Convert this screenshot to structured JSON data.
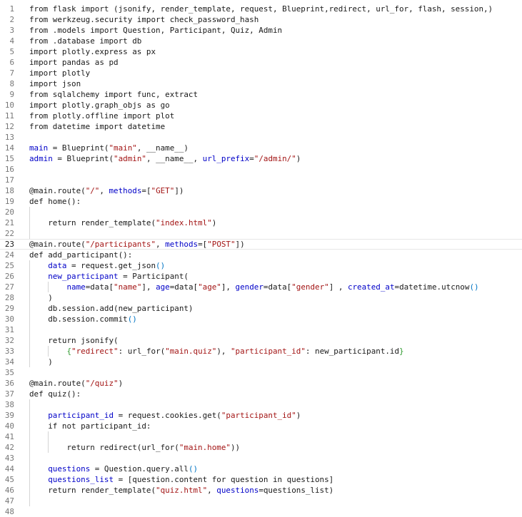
{
  "editor": {
    "current_line": 23,
    "lines": [
      {
        "n": "1",
        "indent": 0,
        "parts": [
          {
            "t": "from flask import (jsonify, render_template, request, Blueprint,redirect, url_for, flash, session,)",
            "c": "plain"
          }
        ]
      },
      {
        "n": "2",
        "indent": 0,
        "parts": [
          {
            "t": "from werkzeug.security import check_password_hash",
            "c": "plain"
          }
        ]
      },
      {
        "n": "3",
        "indent": 0,
        "parts": [
          {
            "t": "from .models import Question, Participant, Quiz, Admin",
            "c": "plain"
          }
        ]
      },
      {
        "n": "4",
        "indent": 0,
        "parts": [
          {
            "t": "from .database import db",
            "c": "plain"
          }
        ]
      },
      {
        "n": "5",
        "indent": 0,
        "parts": [
          {
            "t": "import plotly.express as px",
            "c": "plain"
          }
        ]
      },
      {
        "n": "6",
        "indent": 0,
        "parts": [
          {
            "t": "import pandas as pd",
            "c": "plain"
          }
        ]
      },
      {
        "n": "7",
        "indent": 0,
        "parts": [
          {
            "t": "import plotly",
            "c": "plain"
          }
        ]
      },
      {
        "n": "8",
        "indent": 0,
        "parts": [
          {
            "t": "import json",
            "c": "plain"
          }
        ]
      },
      {
        "n": "9",
        "indent": 0,
        "parts": [
          {
            "t": "from sqlalchemy import func, extract",
            "c": "plain"
          }
        ]
      },
      {
        "n": "10",
        "indent": 0,
        "parts": [
          {
            "t": "import plotly.graph_objs as go",
            "c": "plain"
          }
        ]
      },
      {
        "n": "11",
        "indent": 0,
        "parts": [
          {
            "t": "from plotly.offline import plot",
            "c": "plain"
          }
        ]
      },
      {
        "n": "12",
        "indent": 0,
        "parts": [
          {
            "t": "from datetime import datetime",
            "c": "plain"
          }
        ]
      },
      {
        "n": "13",
        "indent": 0,
        "parts": []
      },
      {
        "n": "14",
        "indent": 0,
        "parts": [
          {
            "t": "main",
            "c": "var"
          },
          {
            "t": " = Blueprint(",
            "c": "plain"
          },
          {
            "t": "\"main\"",
            "c": "str"
          },
          {
            "t": ", __name__)",
            "c": "plain"
          }
        ]
      },
      {
        "n": "15",
        "indent": 0,
        "parts": [
          {
            "t": "admin",
            "c": "var"
          },
          {
            "t": " = Blueprint(",
            "c": "plain"
          },
          {
            "t": "\"admin\"",
            "c": "str"
          },
          {
            "t": ", __name__, ",
            "c": "plain"
          },
          {
            "t": "url_prefix",
            "c": "var"
          },
          {
            "t": "=",
            "c": "plain"
          },
          {
            "t": "\"/admin/\"",
            "c": "str"
          },
          {
            "t": ")",
            "c": "plain"
          }
        ]
      },
      {
        "n": "16",
        "indent": 0,
        "parts": []
      },
      {
        "n": "17",
        "indent": 0,
        "parts": []
      },
      {
        "n": "18",
        "indent": 0,
        "parts": [
          {
            "t": "@main.route(",
            "c": "plain"
          },
          {
            "t": "\"/\"",
            "c": "str"
          },
          {
            "t": ", ",
            "c": "plain"
          },
          {
            "t": "methods",
            "c": "var"
          },
          {
            "t": "=[",
            "c": "plain"
          },
          {
            "t": "\"GET\"",
            "c": "str"
          },
          {
            "t": "])",
            "c": "plain"
          }
        ]
      },
      {
        "n": "19",
        "indent": 0,
        "parts": [
          {
            "t": "def home():",
            "c": "plain"
          }
        ]
      },
      {
        "n": "20",
        "indent": 1,
        "parts": []
      },
      {
        "n": "21",
        "indent": 1,
        "parts": [
          {
            "t": "    return render_template(",
            "c": "plain"
          },
          {
            "t": "\"index.html\"",
            "c": "str"
          },
          {
            "t": ")",
            "c": "plain"
          }
        ]
      },
      {
        "n": "22",
        "indent": 1,
        "parts": []
      },
      {
        "n": "23",
        "indent": 0,
        "parts": [
          {
            "t": "@main.route(",
            "c": "plain"
          },
          {
            "t": "\"/participants\"",
            "c": "str"
          },
          {
            "t": ", ",
            "c": "plain"
          },
          {
            "t": "methods",
            "c": "var"
          },
          {
            "t": "=[",
            "c": "plain"
          },
          {
            "t": "\"POST\"",
            "c": "str"
          },
          {
            "t": "])",
            "c": "plain"
          }
        ]
      },
      {
        "n": "24",
        "indent": 0,
        "parts": [
          {
            "t": "def add_participant():",
            "c": "plain"
          }
        ]
      },
      {
        "n": "25",
        "indent": 1,
        "parts": [
          {
            "t": "    ",
            "c": "plain"
          },
          {
            "t": "data",
            "c": "var"
          },
          {
            "t": " = request.get_json",
            "c": "plain"
          },
          {
            "t": "()",
            "c": "lpar"
          }
        ]
      },
      {
        "n": "26",
        "indent": 1,
        "parts": [
          {
            "t": "    ",
            "c": "plain"
          },
          {
            "t": "new_participant",
            "c": "var"
          },
          {
            "t": " = Participant(",
            "c": "plain"
          }
        ]
      },
      {
        "n": "27",
        "indent": 2,
        "parts": [
          {
            "t": "        ",
            "c": "plain"
          },
          {
            "t": "name",
            "c": "var"
          },
          {
            "t": "=data[",
            "c": "plain"
          },
          {
            "t": "\"name\"",
            "c": "str"
          },
          {
            "t": "], ",
            "c": "plain"
          },
          {
            "t": "age",
            "c": "var"
          },
          {
            "t": "=data[",
            "c": "plain"
          },
          {
            "t": "\"age\"",
            "c": "str"
          },
          {
            "t": "], ",
            "c": "plain"
          },
          {
            "t": "gender",
            "c": "var"
          },
          {
            "t": "=data[",
            "c": "plain"
          },
          {
            "t": "\"gender\"",
            "c": "str"
          },
          {
            "t": "] , ",
            "c": "plain"
          },
          {
            "t": "created_at",
            "c": "var"
          },
          {
            "t": "=datetime.utcnow",
            "c": "plain"
          },
          {
            "t": "()",
            "c": "lpar"
          }
        ]
      },
      {
        "n": "28",
        "indent": 1,
        "parts": [
          {
            "t": "    )",
            "c": "plain"
          }
        ]
      },
      {
        "n": "29",
        "indent": 1,
        "parts": [
          {
            "t": "    db.session.add(new_participant)",
            "c": "plain"
          }
        ]
      },
      {
        "n": "30",
        "indent": 1,
        "parts": [
          {
            "t": "    db.session.commit",
            "c": "plain"
          },
          {
            "t": "()",
            "c": "lpar"
          }
        ]
      },
      {
        "n": "31",
        "indent": 1,
        "parts": []
      },
      {
        "n": "32",
        "indent": 1,
        "parts": [
          {
            "t": "    return jsonify(",
            "c": "plain"
          }
        ]
      },
      {
        "n": "33",
        "indent": 2,
        "parts": [
          {
            "t": "        ",
            "c": "plain"
          },
          {
            "t": "{",
            "c": "gpar"
          },
          {
            "t": "\"redirect\"",
            "c": "str"
          },
          {
            "t": ": url_for(",
            "c": "plain"
          },
          {
            "t": "\"main.quiz\"",
            "c": "str"
          },
          {
            "t": "), ",
            "c": "plain"
          },
          {
            "t": "\"participant_id\"",
            "c": "str"
          },
          {
            "t": ": new_participant.id",
            "c": "plain"
          },
          {
            "t": "}",
            "c": "gpar"
          }
        ]
      },
      {
        "n": "34",
        "indent": 1,
        "parts": [
          {
            "t": "    )",
            "c": "plain"
          }
        ]
      },
      {
        "n": "35",
        "indent": 0,
        "parts": []
      },
      {
        "n": "36",
        "indent": 0,
        "parts": [
          {
            "t": "@main.route(",
            "c": "plain"
          },
          {
            "t": "\"/quiz\"",
            "c": "str"
          },
          {
            "t": ")",
            "c": "plain"
          }
        ]
      },
      {
        "n": "37",
        "indent": 0,
        "parts": [
          {
            "t": "def quiz():",
            "c": "plain"
          }
        ]
      },
      {
        "n": "38",
        "indent": 1,
        "parts": []
      },
      {
        "n": "39",
        "indent": 1,
        "parts": [
          {
            "t": "    ",
            "c": "plain"
          },
          {
            "t": "participant_id",
            "c": "var"
          },
          {
            "t": " = request.cookies.get(",
            "c": "plain"
          },
          {
            "t": "\"participant_id\"",
            "c": "str"
          },
          {
            "t": ")",
            "c": "plain"
          }
        ]
      },
      {
        "n": "40",
        "indent": 1,
        "parts": [
          {
            "t": "    if not participant_id:",
            "c": "plain"
          }
        ]
      },
      {
        "n": "41",
        "indent": 2,
        "parts": []
      },
      {
        "n": "42",
        "indent": 2,
        "parts": [
          {
            "t": "        return redirect(url_for(",
            "c": "plain"
          },
          {
            "t": "\"main.home\"",
            "c": "str"
          },
          {
            "t": "))",
            "c": "plain"
          }
        ]
      },
      {
        "n": "43",
        "indent": 1,
        "parts": []
      },
      {
        "n": "44",
        "indent": 1,
        "parts": [
          {
            "t": "    ",
            "c": "plain"
          },
          {
            "t": "questions",
            "c": "var"
          },
          {
            "t": " = Question.query.all",
            "c": "plain"
          },
          {
            "t": "()",
            "c": "lpar"
          }
        ]
      },
      {
        "n": "45",
        "indent": 1,
        "parts": [
          {
            "t": "    ",
            "c": "plain"
          },
          {
            "t": "questions_list",
            "c": "var"
          },
          {
            "t": " = [question.content for question in questions]",
            "c": "plain"
          }
        ]
      },
      {
        "n": "46",
        "indent": 1,
        "parts": [
          {
            "t": "    return render_template(",
            "c": "plain"
          },
          {
            "t": "\"quiz.html\"",
            "c": "str"
          },
          {
            "t": ", ",
            "c": "plain"
          },
          {
            "t": "questions",
            "c": "var"
          },
          {
            "t": "=questions_list)",
            "c": "plain"
          }
        ]
      },
      {
        "n": "47",
        "indent": 1,
        "parts": []
      },
      {
        "n": "48",
        "indent": 0,
        "parts": []
      }
    ]
  }
}
